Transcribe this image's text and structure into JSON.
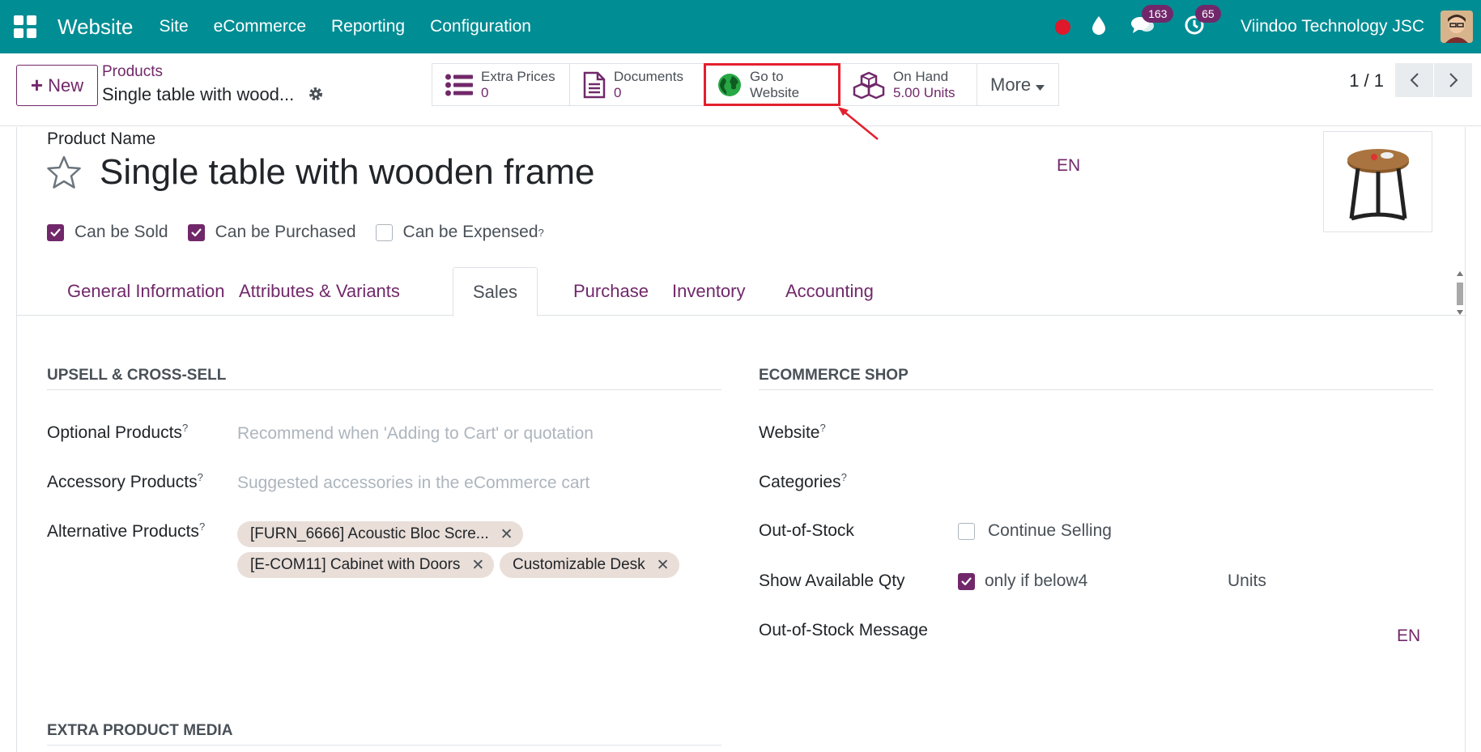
{
  "navbar": {
    "brand": "Website",
    "menu": [
      "Site",
      "eCommerce",
      "Reporting",
      "Configuration"
    ],
    "messages_badge": "163",
    "activities_badge": "65",
    "company": "Viindoo Technology JSC"
  },
  "control_panel": {
    "new_label": "New",
    "breadcrumb_parent": "Products",
    "breadcrumb_current": "Single table with wood...",
    "stats": {
      "extra_prices": {
        "label": "Extra Prices",
        "value": "0"
      },
      "documents": {
        "label": "Documents",
        "value": "0"
      },
      "website": {
        "label_line1": "Go to",
        "label_line2": "Website"
      },
      "on_hand": {
        "label": "On Hand",
        "value": "5.00 Units"
      },
      "more": "More"
    },
    "pager": "1 / 1"
  },
  "form": {
    "name_label": "Product Name",
    "product_name": "Single table with wooden frame",
    "lang": "EN",
    "checkboxes": {
      "can_be_sold": "Can be Sold",
      "can_be_purchased": "Can be Purchased",
      "can_be_expensed": "Can be Expensed"
    },
    "tabs": [
      "General Information",
      "Attributes & Variants",
      "Sales",
      "Purchase",
      "Inventory",
      "Accounting"
    ],
    "upsell": {
      "title": "UPSELL & CROSS-SELL",
      "optional_label": "Optional Products",
      "optional_placeholder": "Recommend when 'Adding to Cart' or quotation",
      "accessory_label": "Accessory Products",
      "accessory_placeholder": "Suggested accessories in the eCommerce cart",
      "alternative_label": "Alternative Products",
      "alternative_tags": [
        "[FURN_6666] Acoustic Bloc Scre...",
        "[E-COM11] Cabinet with Doors",
        "Customizable Desk"
      ]
    },
    "ecommerce": {
      "title": "ECOMMERCE SHOP",
      "website_label": "Website",
      "categories_label": "Categories",
      "out_of_stock_label": "Out-of-Stock",
      "continue_selling": "Continue Selling",
      "show_qty_label": "Show Available Qty",
      "only_if_below": "only if below",
      "qty_threshold": "4",
      "units": "Units",
      "oos_message_label": "Out-of-Stock Message",
      "lang": "EN"
    },
    "media": {
      "title": "EXTRA PRODUCT MEDIA"
    }
  },
  "help_mark": "?",
  "colors": {
    "navbar": "#018d94",
    "accent": "#71286a",
    "highlight": "#e3202e"
  }
}
